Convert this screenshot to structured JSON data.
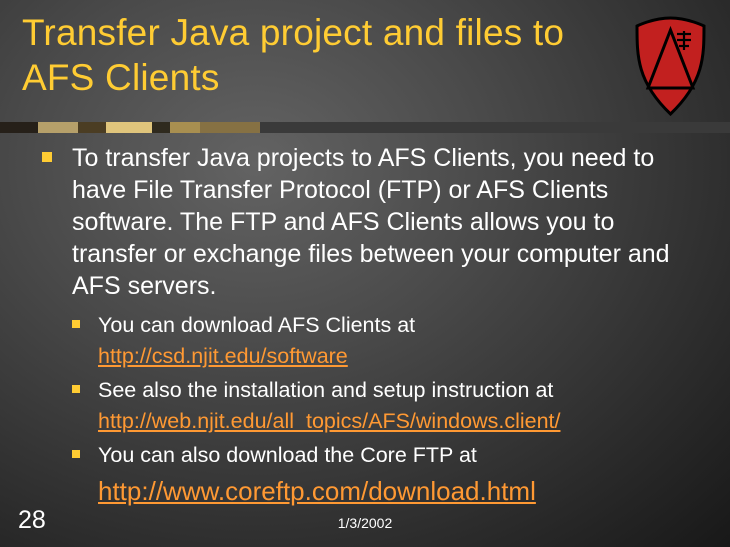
{
  "title": "Transfer Java project and files to AFS Clients",
  "bullets": {
    "main": "To transfer Java projects to AFS Clients, you need to have File Transfer Protocol (FTP) or AFS Clients software. The FTP and AFS Clients allows you to transfer or exchange files between your computer and AFS servers.",
    "sub": [
      {
        "text": "You can download AFS Clients at",
        "link": "http://csd.njit.edu/software"
      },
      {
        "text": "See also the installation and setup instruction at",
        "link": "http://web.njit.edu/all_topics/AFS/windows.client/"
      },
      {
        "text": "You can also download the Core FTP at",
        "link": "http://www.coreftp.com/download.html",
        "big": true
      }
    ]
  },
  "pageNumber": "28",
  "date": "1/3/2002",
  "ornament_colors": [
    "#262019",
    "#b6a06a",
    "#4b3d23",
    "#e0c57c",
    "#2f2a1e",
    "#a88f50",
    "#867143",
    "#3a3a3a",
    "#3a3a3a",
    "#3a3a3a",
    "#3a3a3a",
    "#3a3a3a",
    "#3a3a3a"
  ],
  "ornament_widths": [
    38,
    40,
    28,
    46,
    18,
    30,
    60,
    70,
    80,
    80,
    80,
    80,
    80
  ]
}
